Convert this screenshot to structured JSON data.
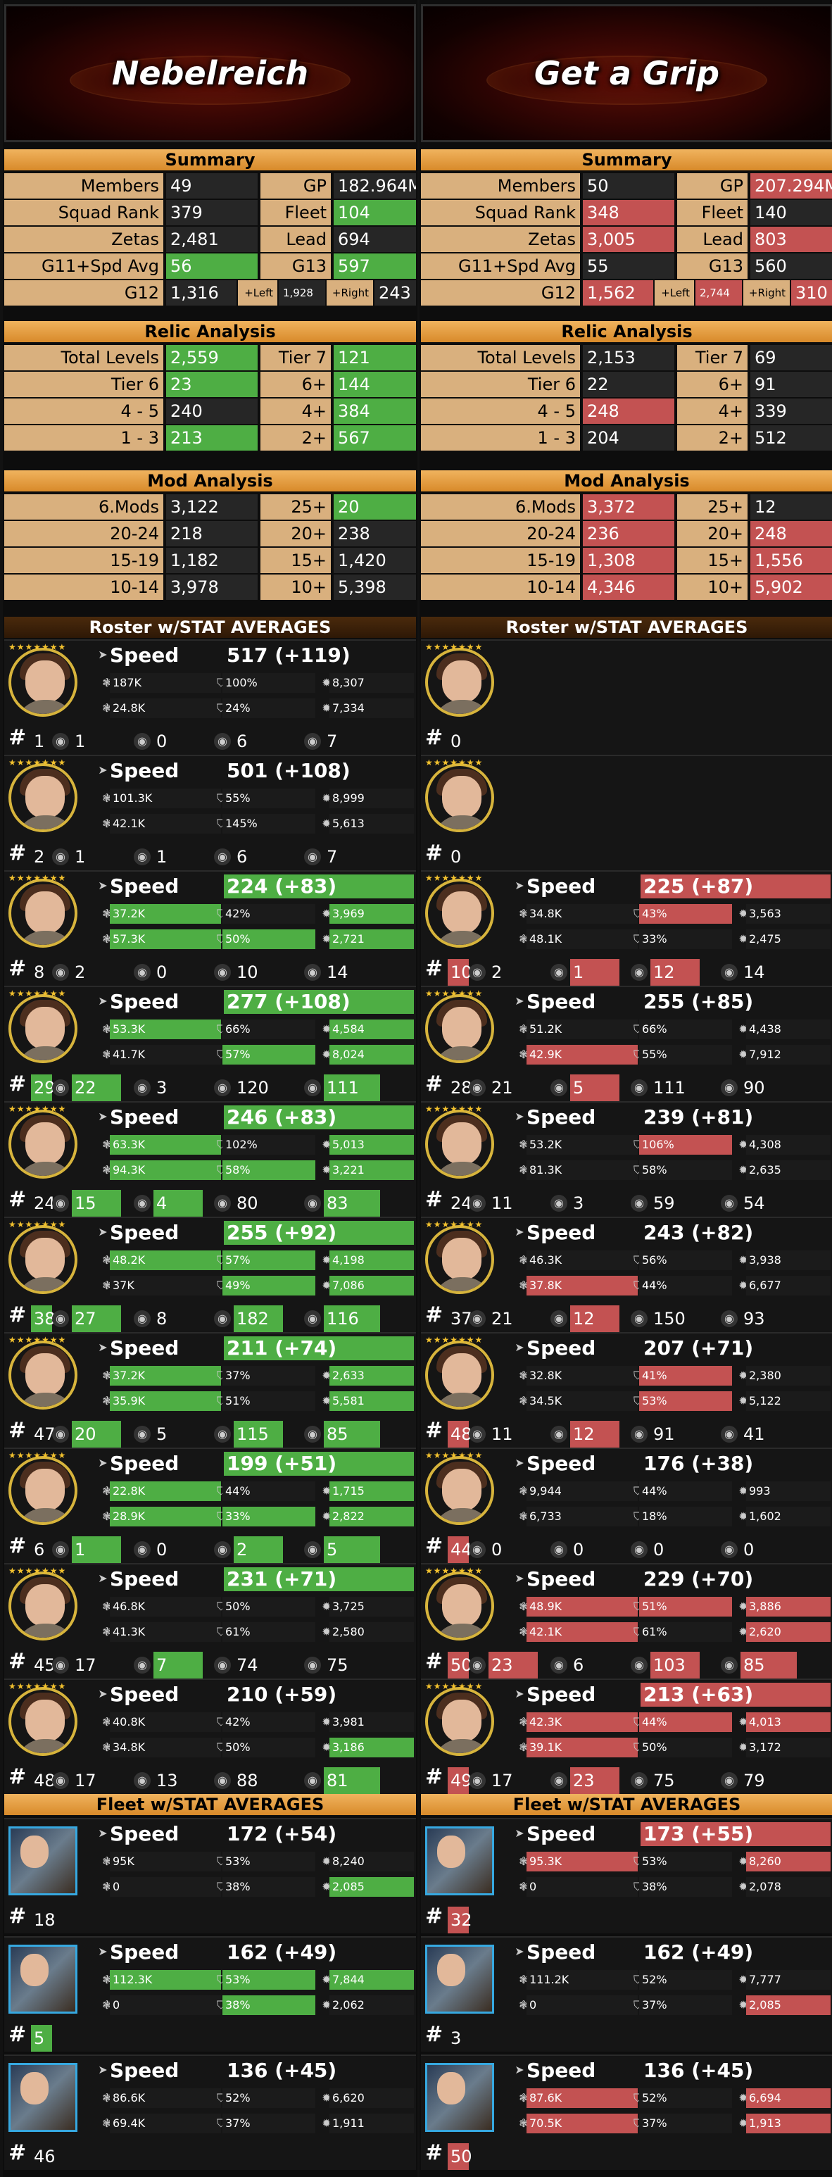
{
  "guilds": [
    {
      "name": "Nebelreich",
      "summary_title": "Summary",
      "summary": {
        "members_label": "Members",
        "members": "49",
        "gp_label": "GP",
        "gp": "182.964M",
        "squad_rank_label": "Squad Rank",
        "squad_rank": "379",
        "fleet_label": "Fleet",
        "fleet": "104",
        "zetas_label": "Zetas",
        "zetas": "2,481",
        "lead_label": "Lead",
        "lead": "694",
        "g11_label": "G11+Spd Avg",
        "g11": "56",
        "g13_label": "G13",
        "g13": "597",
        "g12_label": "G12",
        "g12": "1,316",
        "left_label": "+Left",
        "left": "1,928",
        "right_label": "+Right",
        "right": "243"
      },
      "relic_title": "Relic Analysis",
      "relic": {
        "total_label": "Total Levels",
        "total": "2,559",
        "t7_label": "Tier 7",
        "t7": "121",
        "t6_label": "Tier 6",
        "t6": "23",
        "six_plus_label": "6+",
        "six_plus": "144",
        "r45_label": "4 - 5",
        "r45": "240",
        "four_plus_label": "4+",
        "four_plus": "384",
        "r13_label": "1 - 3",
        "r13": "213",
        "two_plus_label": "2+",
        "two_plus": "567"
      },
      "mod_title": "Mod Analysis",
      "mods": {
        "six_label": "6.Mods",
        "six": "3,122",
        "p25_label": "25+",
        "p25": "20",
        "r2024_label": "20-24",
        "r2024": "218",
        "p20_label": "20+",
        "p20": "238",
        "r1519_label": "15-19",
        "r1519": "1,182",
        "p15_label": "15+",
        "p15": "1,420",
        "r1014_label": "10-14",
        "r1014": "3,978",
        "p10_label": "10+",
        "p10": "5,398"
      },
      "roster_title": "Roster w/STAT AVERAGES",
      "fleet_title": "Fleet w/STAT AVERAGES"
    },
    {
      "name": "Get a Grip",
      "summary_title": "Summary",
      "summary": {
        "members_label": "Members",
        "members": "50",
        "gp_label": "GP",
        "gp": "207.294M",
        "squad_rank_label": "Squad Rank",
        "squad_rank": "348",
        "fleet_label": "Fleet",
        "fleet": "140",
        "zetas_label": "Zetas",
        "zetas": "3,005",
        "lead_label": "Lead",
        "lead": "803",
        "g11_label": "G11+Spd Avg",
        "g11": "55",
        "g13_label": "G13",
        "g13": "560",
        "g12_label": "G12",
        "g12": "1,562",
        "left_label": "+Left",
        "left": "2,744",
        "right_label": "+Right",
        "right": "310"
      },
      "relic_title": "Relic Analysis",
      "relic": {
        "total_label": "Total Levels",
        "total": "2,153",
        "t7_label": "Tier 7",
        "t7": "69",
        "t6_label": "Tier 6",
        "t6": "22",
        "six_plus_label": "6+",
        "six_plus": "91",
        "r45_label": "4 - 5",
        "r45": "248",
        "four_plus_label": "4+",
        "four_plus": "339",
        "r13_label": "1 - 3",
        "r13": "204",
        "two_plus_label": "2+",
        "two_plus": "512"
      },
      "mod_title": "Mod Analysis",
      "mods": {
        "six_label": "6.Mods",
        "six": "3,372",
        "p25_label": "25+",
        "p25": "12",
        "r2024_label": "20-24",
        "r2024": "236",
        "p20_label": "20+",
        "p20": "248",
        "r1519_label": "15-19",
        "r1519": "1,308",
        "p15_label": "15+",
        "p15": "1,556",
        "r1014_label": "10-14",
        "r1014": "4,346",
        "p10_label": "10+",
        "p10": "5,902"
      },
      "roster_title": "Roster w/STAT AVERAGES",
      "fleet_title": "Fleet w/STAT AVERAGES"
    }
  ],
  "colors": {
    "win": "#4eae44",
    "lose": "#c35252",
    "cell": "#262626",
    "label": "#d9b07e",
    "header": "#e39a3c"
  },
  "speed_label": "Speed",
  "units_left": [
    {
      "speed": "517 (+119)",
      "hp": "187K",
      "cd": "100%",
      "off": "8,307",
      "prot": "24.8K",
      "pot": "24%",
      "def": "7,334",
      "count": "1",
      "r1": "1",
      "r2": "0",
      "r3": "6",
      "r4": "7",
      "hl": {}
    },
    {
      "speed": "501 (+108)",
      "hp": "101.3K",
      "cd": "55%",
      "off": "8,999",
      "prot": "42.1K",
      "pot": "145%",
      "def": "5,613",
      "count": "2",
      "r1": "1",
      "r2": "1",
      "r3": "6",
      "r4": "7",
      "hl": {}
    },
    {
      "speed": "224 (+83)",
      "hp": "37.2K",
      "cd": "42%",
      "off": "3,969",
      "prot": "57.3K",
      "pot": "50%",
      "def": "2,721",
      "count": "8",
      "r1": "2",
      "r2": "0",
      "r3": "10",
      "r4": "14",
      "hl": {
        "speed": "g",
        "hp": "g",
        "off": "g",
        "prot": "g",
        "pot": "g",
        "def": "g"
      }
    },
    {
      "speed": "277 (+108)",
      "hp": "53.3K",
      "cd": "66%",
      "off": "4,584",
      "prot": "41.7K",
      "pot": "57%",
      "def": "8,024",
      "count": "29",
      "r1": "22",
      "r2": "3",
      "r3": "120",
      "r4": "111",
      "hl": {
        "speed": "g",
        "hp": "g",
        "off": "g",
        "pot": "g",
        "def": "g",
        "count": "g",
        "r1": "g",
        "r4": "g"
      }
    },
    {
      "speed": "246 (+83)",
      "hp": "63.3K",
      "cd": "102%",
      "off": "5,013",
      "prot": "94.3K",
      "pot": "58%",
      "def": "3,221",
      "count": "24",
      "r1": "15",
      "r2": "4",
      "r3": "80",
      "r4": "83",
      "hl": {
        "speed": "g",
        "hp": "g",
        "off": "g",
        "prot": "g",
        "pot": "g",
        "def": "g",
        "r1": "g",
        "r2": "g",
        "r4": "g"
      }
    },
    {
      "speed": "255 (+92)",
      "hp": "48.2K",
      "cd": "57%",
      "off": "4,198",
      "prot": "37K",
      "pot": "49%",
      "def": "7,086",
      "count": "38",
      "r1": "27",
      "r2": "8",
      "r3": "182",
      "r4": "116",
      "hl": {
        "speed": "g",
        "hp": "g",
        "cd": "g",
        "off": "g",
        "pot": "g",
        "def": "g",
        "count": "g",
        "r1": "g",
        "r3": "g",
        "r4": "g"
      }
    },
    {
      "speed": "211 (+74)",
      "hp": "37.2K",
      "cd": "37%",
      "off": "2,633",
      "prot": "35.9K",
      "pot": "51%",
      "def": "5,581",
      "count": "47",
      "r1": "20",
      "r2": "5",
      "r3": "115",
      "r4": "85",
      "hl": {
        "speed": "g",
        "hp": "g",
        "off": "g",
        "prot": "g",
        "def": "g",
        "r1": "g",
        "r3": "g",
        "r4": "g"
      }
    },
    {
      "speed": "199 (+51)",
      "hp": "22.8K",
      "cd": "44%",
      "off": "1,715",
      "prot": "28.9K",
      "pot": "33%",
      "def": "2,822",
      "count": "6",
      "r1": "1",
      "r2": "0",
      "r3": "2",
      "r4": "5",
      "hl": {
        "speed": "g",
        "hp": "g",
        "off": "g",
        "prot": "g",
        "pot": "g",
        "def": "g",
        "r1": "g",
        "r3": "g",
        "r4": "g"
      }
    },
    {
      "speed": "231 (+71)",
      "hp": "46.8K",
      "cd": "50%",
      "off": "3,725",
      "prot": "41.3K",
      "pot": "61%",
      "def": "2,580",
      "count": "45",
      "r1": "17",
      "r2": "7",
      "r3": "74",
      "r4": "75",
      "hl": {
        "speed": "g",
        "r2": "g"
      }
    },
    {
      "speed": "210 (+59)",
      "hp": "40.8K",
      "cd": "42%",
      "off": "3,981",
      "prot": "34.8K",
      "pot": "50%",
      "def": "3,186",
      "count": "48",
      "r1": "17",
      "r2": "13",
      "r3": "88",
      "r4": "81",
      "hl": {
        "def": "g",
        "r4": "g"
      }
    }
  ],
  "units_right": [
    {
      "speed": "",
      "count": "0",
      "empty": true,
      "hl": {}
    },
    {
      "speed": "",
      "count": "0",
      "empty": true,
      "hl": {}
    },
    {
      "speed": "225 (+87)",
      "hp": "34.8K",
      "cd": "43%",
      "off": "3,563",
      "prot": "48.1K",
      "pot": "33%",
      "def": "2,475",
      "count": "10",
      "r1": "2",
      "r2": "1",
      "r3": "12",
      "r4": "14",
      "hl": {
        "speed": "r",
        "cd": "r",
        "count": "r",
        "r2": "r",
        "r3": "r"
      }
    },
    {
      "speed": "255 (+85)",
      "hp": "51.2K",
      "cd": "66%",
      "off": "4,438",
      "prot": "42.9K",
      "pot": "55%",
      "def": "7,912",
      "count": "28",
      "r1": "21",
      "r2": "5",
      "r3": "111",
      "r4": "90",
      "hl": {
        "prot": "r",
        "r2": "r"
      }
    },
    {
      "speed": "239 (+81)",
      "hp": "53.2K",
      "cd": "106%",
      "off": "4,308",
      "prot": "81.3K",
      "pot": "58%",
      "def": "2,635",
      "count": "24",
      "r1": "11",
      "r2": "3",
      "r3": "59",
      "r4": "54",
      "hl": {
        "cd": "r"
      }
    },
    {
      "speed": "243 (+82)",
      "hp": "46.3K",
      "cd": "56%",
      "off": "3,938",
      "prot": "37.8K",
      "pot": "44%",
      "def": "6,677",
      "count": "37",
      "r1": "21",
      "r2": "12",
      "r3": "150",
      "r4": "93",
      "hl": {
        "prot": "r",
        "r2": "r"
      }
    },
    {
      "speed": "207 (+71)",
      "hp": "32.8K",
      "cd": "41%",
      "off": "2,380",
      "prot": "34.5K",
      "pot": "53%",
      "def": "5,122",
      "count": "48",
      "r1": "11",
      "r2": "12",
      "r3": "91",
      "r4": "41",
      "hl": {
        "cd": "r",
        "pot": "r",
        "count": "r",
        "r2": "r"
      }
    },
    {
      "speed": "176 (+38)",
      "hp": "9,944",
      "cd": "44%",
      "off": "993",
      "prot": "6,733",
      "pot": "18%",
      "def": "1,602",
      "count": "44",
      "r1": "0",
      "r2": "0",
      "r3": "0",
      "r4": "0",
      "hl": {
        "count": "r"
      }
    },
    {
      "speed": "229 (+70)",
      "hp": "48.9K",
      "cd": "51%",
      "off": "3,886",
      "prot": "42.1K",
      "pot": "61%",
      "def": "2,620",
      "count": "50",
      "r1": "23",
      "r2": "6",
      "r3": "103",
      "r4": "85",
      "hl": {
        "hp": "r",
        "cd": "r",
        "off": "r",
        "prot": "r",
        "def": "r",
        "count": "r",
        "r1": "r",
        "r3": "r",
        "r4": "r"
      }
    },
    {
      "speed": "213 (+63)",
      "hp": "42.3K",
      "cd": "44%",
      "off": "4,013",
      "prot": "39.1K",
      "pot": "50%",
      "def": "3,172",
      "count": "49",
      "r1": "17",
      "r2": "23",
      "r3": "75",
      "r4": "79",
      "hl": {
        "speed": "r",
        "hp": "r",
        "cd": "r",
        "off": "r",
        "prot": "r",
        "count": "r",
        "r2": "r"
      }
    }
  ],
  "ships_left": [
    {
      "speed": "172 (+54)",
      "hp": "95K",
      "cd": "53%",
      "off": "8,240",
      "prot": "0",
      "pot": "38%",
      "def": "2,085",
      "count": "18",
      "hl": {
        "def": "g"
      }
    },
    {
      "speed": "162 (+49)",
      "hp": "112.3K",
      "cd": "53%",
      "off": "7,844",
      "prot": "0",
      "pot": "38%",
      "def": "2,062",
      "count": "5",
      "hl": {
        "hp": "g",
        "cd": "g",
        "off": "g",
        "pot": "g",
        "count": "g"
      }
    },
    {
      "speed": "136 (+45)",
      "hp": "86.6K",
      "cd": "52%",
      "off": "6,620",
      "prot": "69.4K",
      "pot": "37%",
      "def": "1,911",
      "count": "46",
      "hl": {}
    }
  ],
  "ships_right": [
    {
      "speed": "173 (+55)",
      "hp": "95.3K",
      "cd": "53%",
      "off": "8,260",
      "prot": "0",
      "pot": "38%",
      "def": "2,078",
      "count": "32",
      "hl": {
        "speed": "r",
        "hp": "r",
        "off": "r",
        "count": "r"
      }
    },
    {
      "speed": "162 (+49)",
      "hp": "111.2K",
      "cd": "52%",
      "off": "7,777",
      "prot": "0",
      "pot": "37%",
      "def": "2,085",
      "count": "3",
      "hl": {
        "def": "r"
      }
    },
    {
      "speed": "136 (+45)",
      "hp": "87.6K",
      "cd": "52%",
      "off": "6,694",
      "prot": "70.5K",
      "pot": "37%",
      "def": "1,913",
      "count": "50",
      "hl": {
        "hp": "r",
        "off": "r",
        "prot": "r",
        "def": "r",
        "count": "r"
      }
    }
  ]
}
